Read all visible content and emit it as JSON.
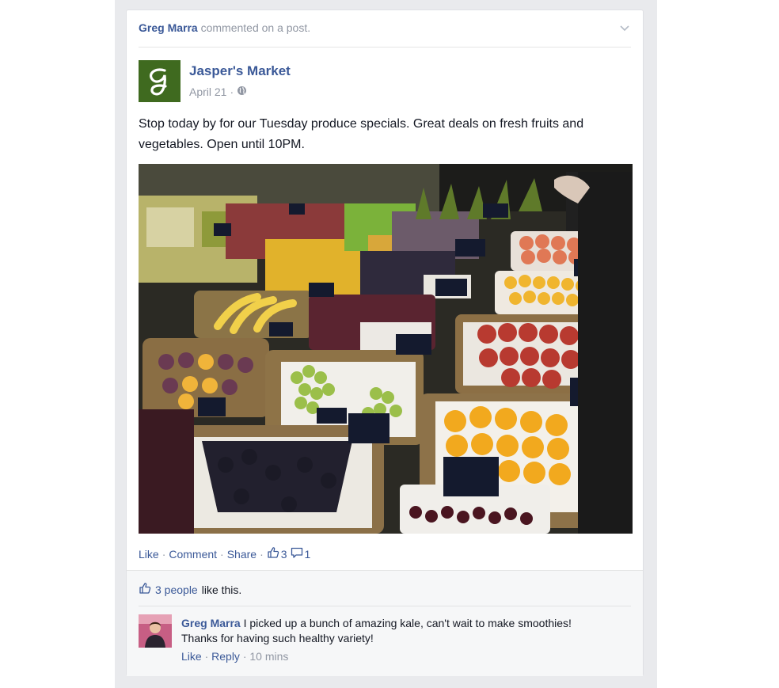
{
  "story": {
    "actor": "Greg Marra",
    "action": "commented on a post."
  },
  "post": {
    "page_name": "Jasper's Market",
    "logo_letter": "g",
    "date": "April 21",
    "separator": "·",
    "text": "Stop today by for our Tuesday produce specials. Great deals on fresh fruits and vegetables. Open until 10PM."
  },
  "actions": {
    "like": "Like",
    "comment": "Comment",
    "share": "Share",
    "like_count": "3",
    "comment_count": "1",
    "sep": "·"
  },
  "likes": {
    "people": "3 people",
    "suffix": "like this."
  },
  "comment": {
    "author": "Greg Marra",
    "text": "I picked up a bunch of amazing kale, can't wait to make smoothies! Thanks for having such healthy variety!",
    "like": "Like",
    "reply": "Reply",
    "time": "10 mins",
    "sep": "·"
  },
  "colors": {
    "link": "#3b5998",
    "muted": "#9197a3",
    "logo_bg": "#3f6a1f"
  }
}
